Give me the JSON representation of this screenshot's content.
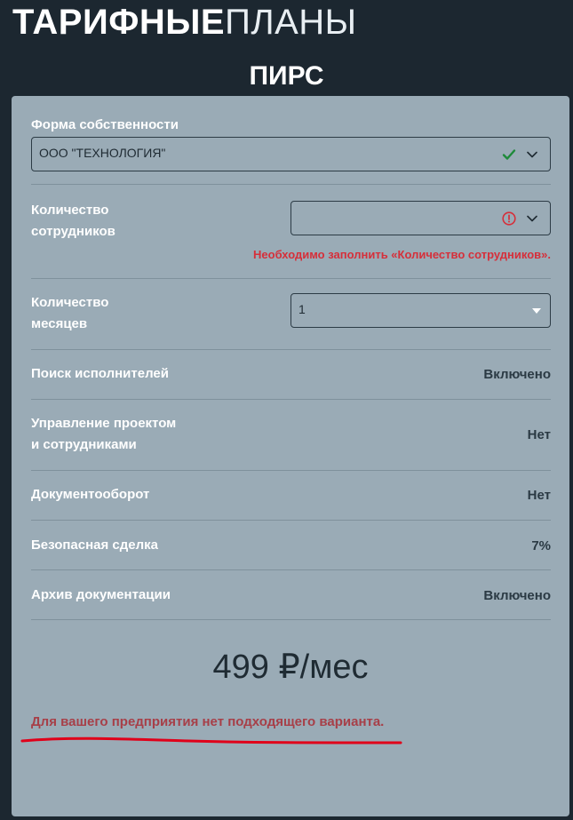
{
  "header": {
    "title_bold": "ТАРИФНЫЕ",
    "title_light": "ПЛАНЫ",
    "plan_name": "ПИРС"
  },
  "form": {
    "ownership": {
      "label": "Форма собственности",
      "value": "ООО \"ТЕХНОЛОГИЯ\""
    },
    "employees": {
      "label_line1": "Количество",
      "label_line2": "сотрудников",
      "value": "",
      "error": "Необходимо заполнить «Количество сотрудников»."
    },
    "months": {
      "label_line1": "Количество",
      "label_line2": "месяцев",
      "value": "1"
    }
  },
  "features": [
    {
      "label_line1": "Поиск исполнителей",
      "label_line2": "",
      "value": "Включено"
    },
    {
      "label_line1": "Управление проектом",
      "label_line2": "и сотрудниками",
      "value": "Нет"
    },
    {
      "label_line1": "Документооборот",
      "label_line2": "",
      "value": "Нет"
    },
    {
      "label_line1": "Безопасная сделка",
      "label_line2": "",
      "value": "7%"
    },
    {
      "label_line1": "Архив документации",
      "label_line2": "",
      "value": "Включено"
    }
  ],
  "price": {
    "amount": "499",
    "unit": "₽/мес"
  },
  "warning": "Для вашего предприятия нет подходящего варианта.",
  "colors": {
    "background": "#1c2730",
    "card": "#9aabb6",
    "error": "#d62f3a",
    "success": "#1e8a3a",
    "annotation": "#e0001a"
  }
}
